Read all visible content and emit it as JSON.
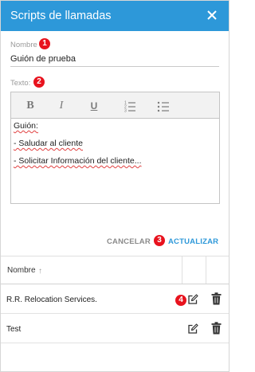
{
  "dialog": {
    "title": "Scripts de llamadas",
    "close_icon": "close-icon",
    "header_color": "#2d98d9"
  },
  "form": {
    "name_label": "Nombre",
    "name_value": "Guión de prueba",
    "text_label": "Texto:",
    "toolbar": {
      "bold": "B",
      "italic": "I",
      "underline": "U",
      "ordered_list_icon": "ordered-list-icon",
      "unordered_list_icon": "unordered-list-icon"
    },
    "editor_lines": [
      "Guión:",
      "- Saludar al cliente",
      "- Solicitar Información del cliente..."
    ]
  },
  "actions": {
    "cancel_label": "CANCELAR",
    "update_label": "ACTUALIZAR"
  },
  "badges": [
    "1",
    "2",
    "3",
    "4"
  ],
  "badge_color": "#e8131e",
  "table": {
    "column_name": "Nombre",
    "sort_icon": "sort-arrow-up-icon",
    "rows": [
      {
        "name": "R.R. Relocation Services."
      },
      {
        "name": "Test"
      }
    ]
  }
}
